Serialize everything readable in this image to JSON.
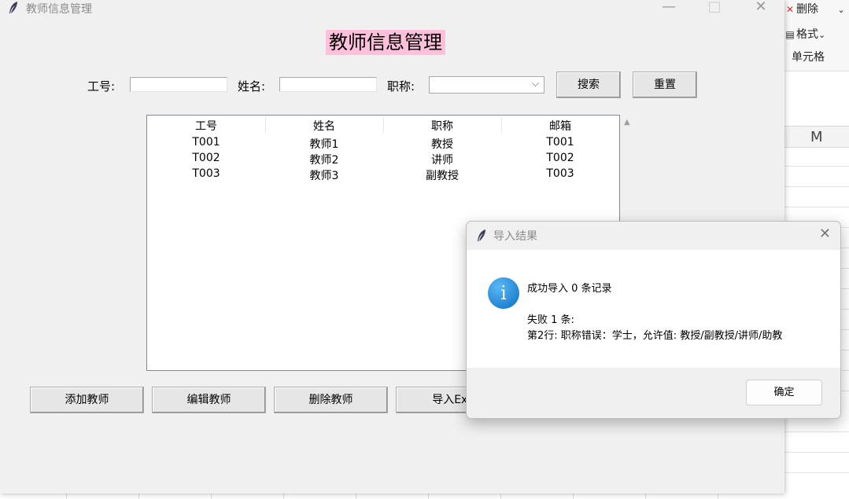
{
  "window": {
    "title": "教师信息管理",
    "controls": {
      "minimize": "—",
      "maximize": "□",
      "close": "✕"
    }
  },
  "heading": "教师信息管理",
  "search": {
    "id_label": "工号:",
    "name_label": "姓名:",
    "title_label": "职称:",
    "id_value": "",
    "name_value": "",
    "title_selected": "",
    "search_button": "搜索",
    "reset_button": "重置"
  },
  "table": {
    "columns": [
      "工号",
      "姓名",
      "职称",
      "邮箱"
    ],
    "rows": [
      [
        "T001",
        "教师1",
        "教授",
        "T001"
      ],
      [
        "T002",
        "教师2",
        "讲师",
        "T002"
      ],
      [
        "T003",
        "教师3",
        "副教授",
        "T003"
      ]
    ]
  },
  "actions": {
    "add": "添加教师",
    "edit": "编辑教师",
    "delete": "删除教师",
    "import": "导入Exc"
  },
  "dialog": {
    "title": "导入结果",
    "line1": "成功导入 0 条记录",
    "line2": "失败 1 条:",
    "line3": "第2行: 职称错误：学士，允许值: 教授/副教授/讲师/助教",
    "ok_button": "确定",
    "icon": "info-icon"
  },
  "background_app": {
    "delete_label": "删除",
    "format_label": "格式",
    "cell_label": "单元格",
    "column_header": "M"
  },
  "colors": {
    "heading_bg": "#ffc0dc",
    "window_bg": "#f0f0f0",
    "info_icon": "#0a6fc2"
  }
}
